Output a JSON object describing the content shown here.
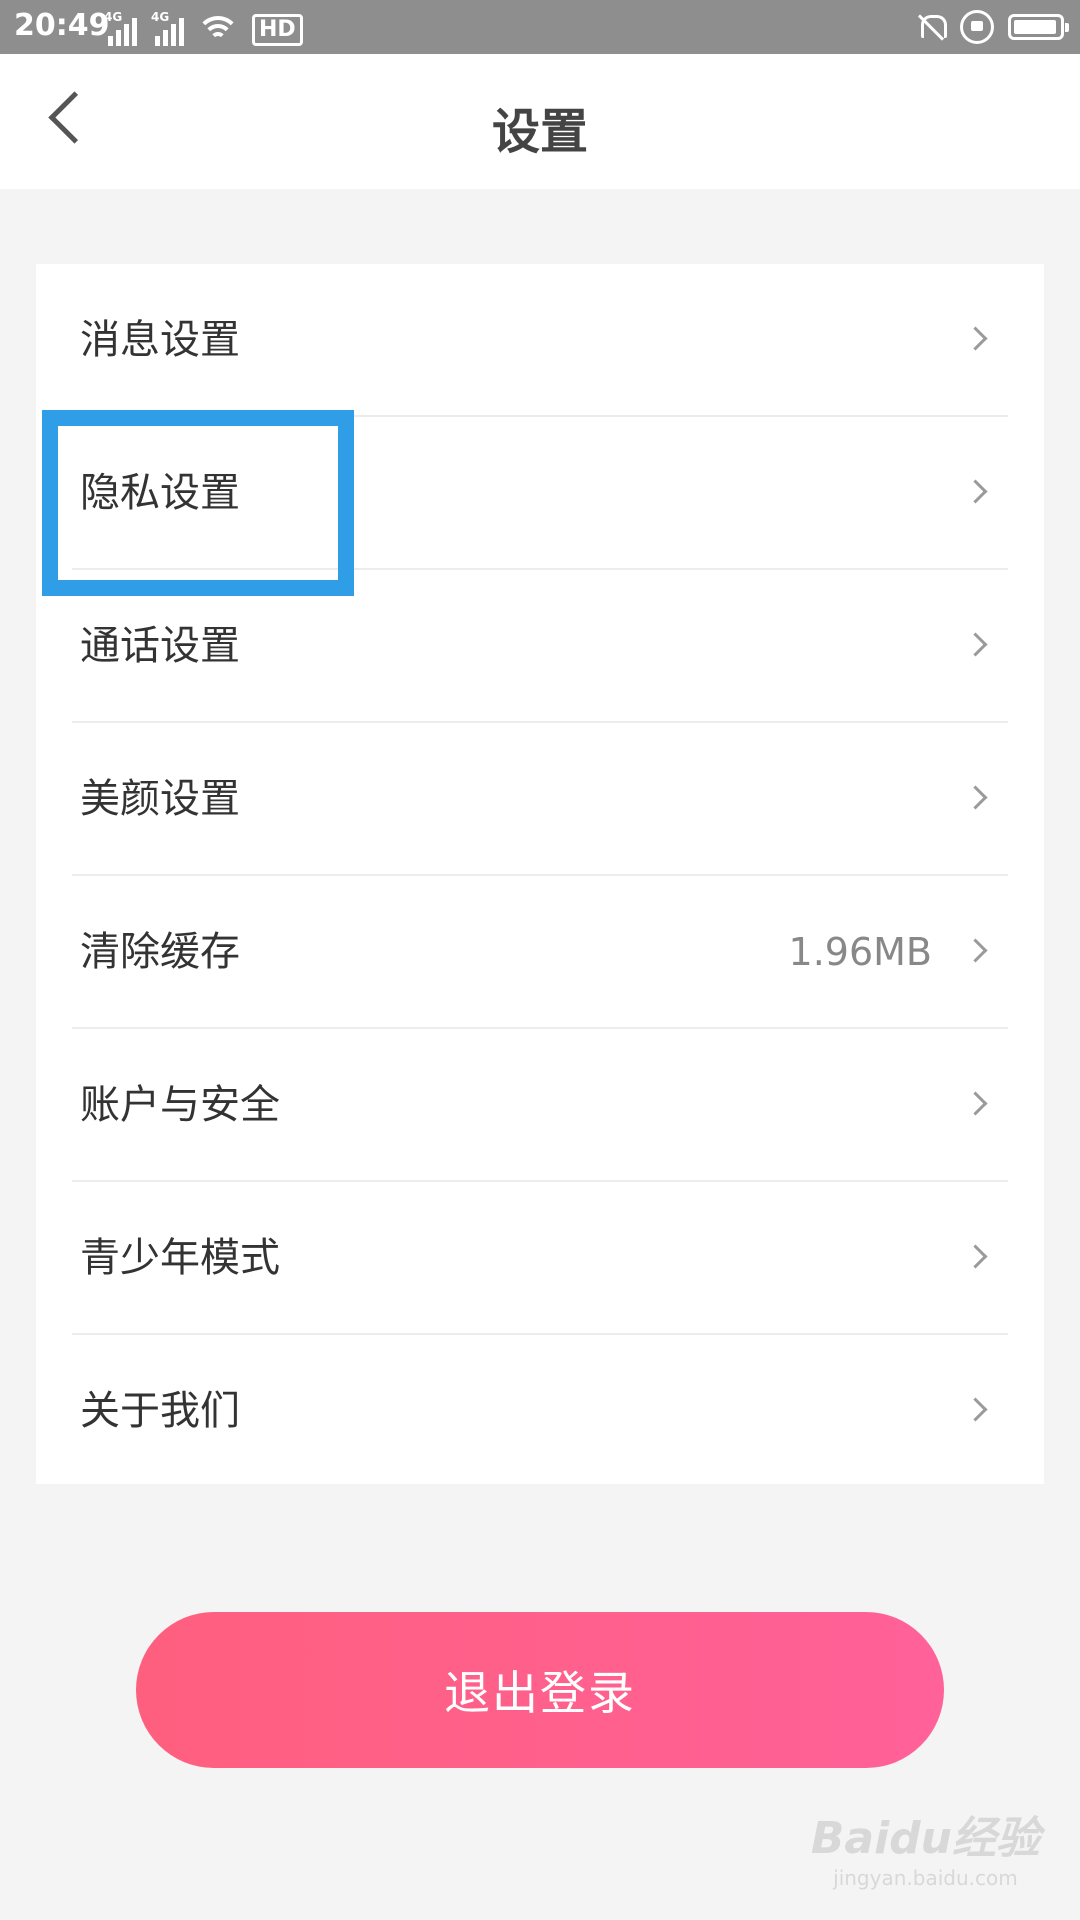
{
  "status_bar": {
    "time": "20:49",
    "network_1": "4G",
    "network_2": "4G",
    "hd_label": "HD",
    "battery_level": 0.95
  },
  "header": {
    "title": "设置"
  },
  "settings": [
    {
      "label": "消息设置",
      "value": ""
    },
    {
      "label": "隐私设置",
      "value": ""
    },
    {
      "label": "通话设置",
      "value": ""
    },
    {
      "label": "美颜设置",
      "value": ""
    },
    {
      "label": "清除缓存",
      "value": "1.96MB"
    },
    {
      "label": "账户与安全",
      "value": ""
    },
    {
      "label": "青少年模式",
      "value": ""
    },
    {
      "label": "关于我们",
      "value": ""
    }
  ],
  "logout": {
    "label": "退出登录",
    "color_start": "#ff5f7e",
    "color_end": "#ff6199"
  },
  "highlight": {
    "color": "#2f9ee6"
  },
  "watermark": {
    "logo": "Baidu经验",
    "url": "jingyan.baidu.com"
  }
}
